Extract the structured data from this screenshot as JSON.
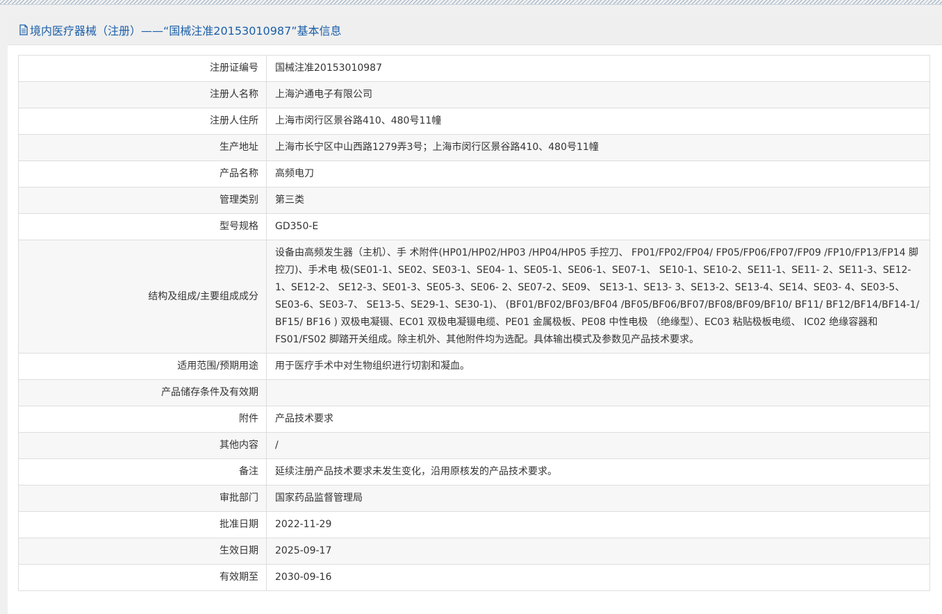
{
  "header": {
    "icon": "document-icon",
    "title": "境内医疗器械（注册）——“国械注准20153010987”基本信息"
  },
  "colors": {
    "title": "#1b5fa8",
    "text": "#333333",
    "row_alt": "#f7f7f7",
    "border": "#dddddd"
  },
  "rows": [
    {
      "label": "注册证编号",
      "value": "国械注准20153010987"
    },
    {
      "label": "注册人名称",
      "value": "上海沪通电子有限公司"
    },
    {
      "label": "注册人住所",
      "value": "上海市闵行区景谷路410、480号11幢"
    },
    {
      "label": "生产地址",
      "value": "上海市长宁区中山西路1279弄3号；上海市闵行区景谷路410、480号11幢"
    },
    {
      "label": "产品名称",
      "value": "高频电刀"
    },
    {
      "label": "管理类别",
      "value": "第三类"
    },
    {
      "label": "型号规格",
      "value": "GD350-E"
    },
    {
      "label": "结构及组成/主要组成成分",
      "value": "设备由高频发生器（主机）、手 术附件(HP01/HP02/HP03 /HP04/HP05 手控刀、 FP01/FP02/FP04/ FP05/FP06/FP07/FP09 /FP10/FP13/FP14 脚控刀)、手术电 极(SE01-1、SE02、SE03-1、SE04- 1、SE05-1、SE06-1、SE07-1、 SE10-1、SE10-2、SE11-1、SE11- 2、SE11-3、SE12-1、SE12-2、 SE12-3、SE01-3、SE05-3、SE06- 2、SE07-2、SE09、 SE13-1、SE13- 3、SE13-2、SE13-4、SE14、SE03- 4、SE03-5、SE03-6、SE03-7、 SE13-5、SE29-1、SE30-1)、 (BF01/BF02/BF03/BF04 /BF05/BF06/BF07/BF08/BF09/BF10/ BF11/ BF12/BF14/BF14-1/ BF15/ BF16 ) 双极电凝镊、EC01 双极电凝镊电缆、PE01 金属极板、PE08 中性电极 （绝缘型）、EC03 粘贴极板电缆、 IC02 绝缘容器和 FS01/FS02 脚踏开关组成。除主机外、其他附件均为选配。具体输出模式及参数见产品技术要求。"
    },
    {
      "label": "适用范围/预期用途",
      "value": "用于医疗手术中对生物组织进行切割和凝血。"
    },
    {
      "label": "产品储存条件及有效期",
      "value": ""
    },
    {
      "label": "附件",
      "value": "产品技术要求"
    },
    {
      "label": "其他内容",
      "value": "/"
    },
    {
      "label": "备注",
      "value": "延续注册产品技术要求未发生变化，沿用原核发的产品技术要求。"
    },
    {
      "label": "审批部门",
      "value": "国家药品监督管理局"
    },
    {
      "label": "批准日期",
      "value": "2022-11-29"
    },
    {
      "label": "生效日期",
      "value": "2025-09-17"
    },
    {
      "label": "有效期至",
      "value": "2030-09-16"
    }
  ]
}
